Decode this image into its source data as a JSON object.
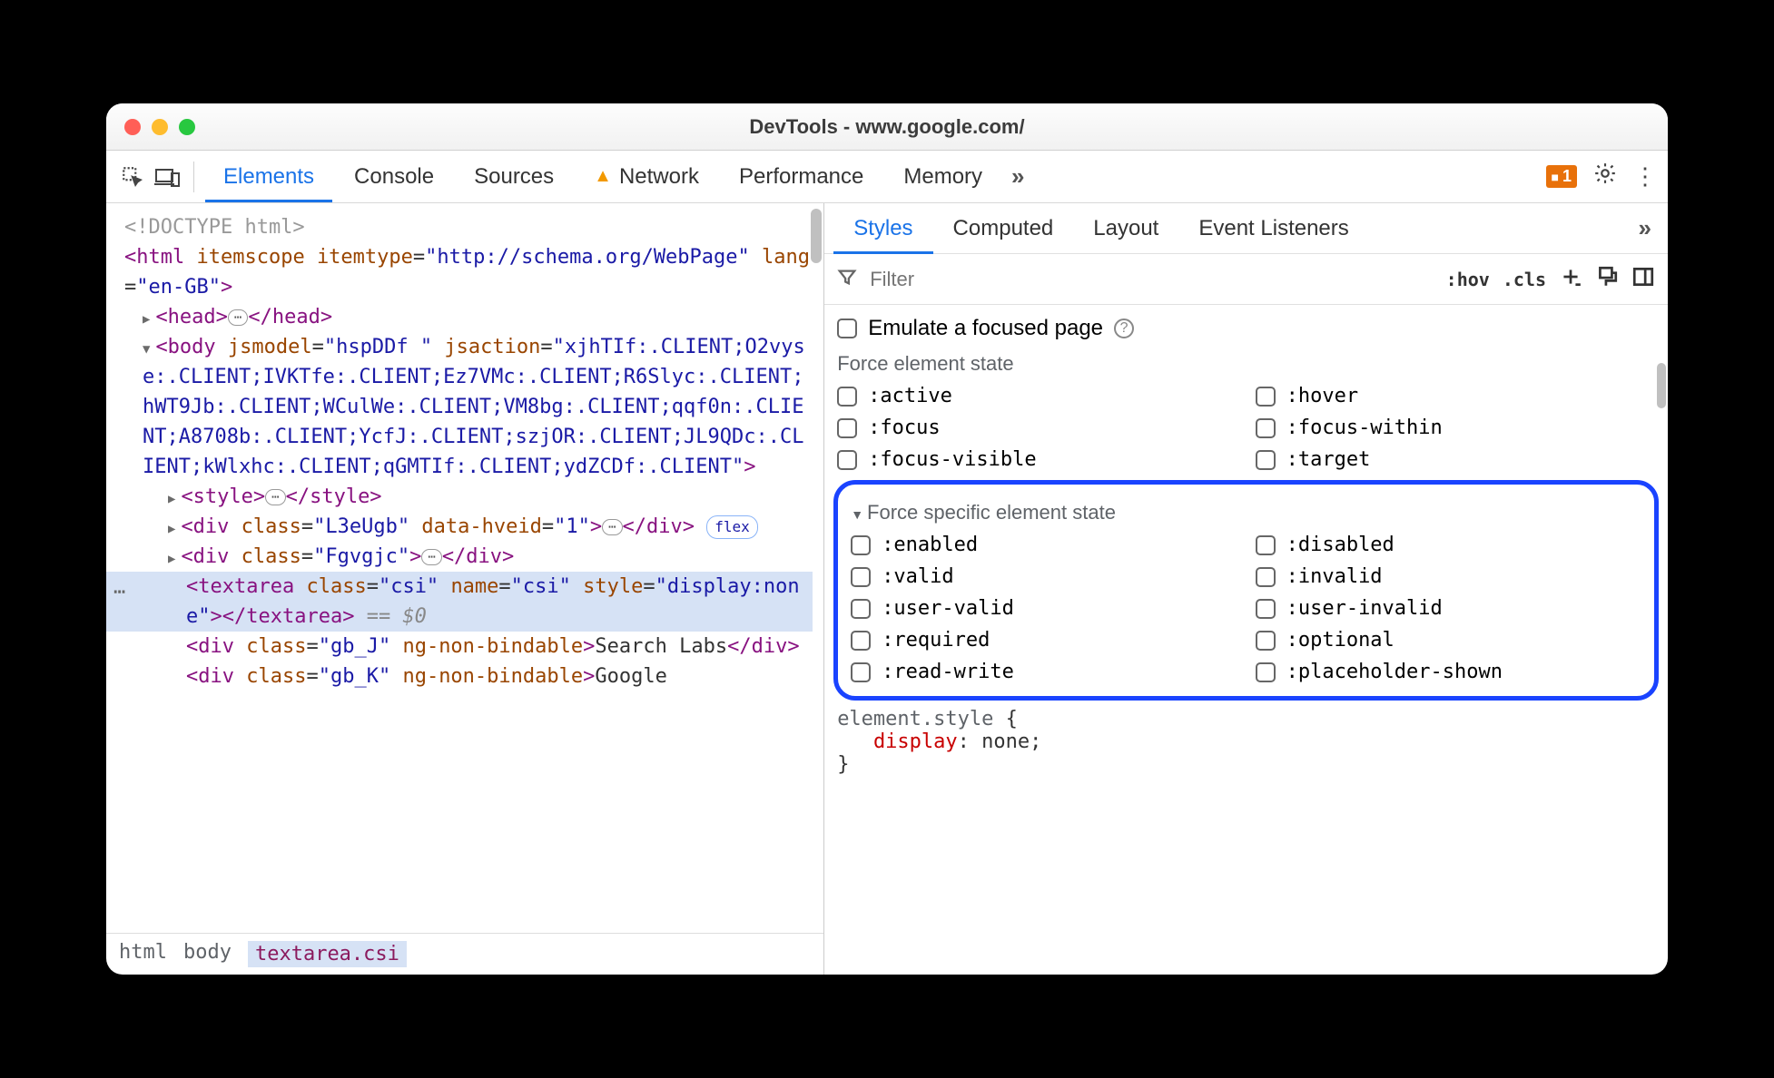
{
  "window": {
    "title": "DevTools - www.google.com/"
  },
  "tabs": {
    "elements": "Elements",
    "console": "Console",
    "sources": "Sources",
    "network": "Network",
    "performance": "Performance",
    "memory": "Memory"
  },
  "issues_count": "1",
  "dom": {
    "doctype": "<!DOCTYPE html>",
    "html_open_1": "<html",
    "html_itemscope": " itemscope ",
    "html_itemtype_attr": "itemtype",
    "html_itemtype_val": "\"http://schema.org/WebPage\"",
    "html_lang_attr": "lang",
    "html_lang_val": "\"en-GB\"",
    "html_close": ">",
    "head_open": "<head>",
    "head_close": "</head>",
    "body_open": "<body",
    "body_jsmodel_attr": "jsmodel",
    "body_jsmodel_val": "\"hspDDf \"",
    "body_jsaction_attr": "jsaction",
    "body_jsaction_val": "\"xjhTIf:.CLIENT;O2vyse:.CLIENT;IVKTfe:.CLIENT;Ez7VMc:.CLIENT;R6Slyc:.CLIENT;hWT9Jb:.CLIENT;WCulWe:.CLIENT;VM8bg:.CLIENT;qqf0n:.CLIENT;A8708b:.CLIENT;YcfJ:.CLIENT;szjOR:.CLIENT;JL9QDc:.CLIENT;kWlxhc:.CLIENT;qGMTIf:.CLIENT;ydZCDf:.CLIENT\"",
    "body_close": ">",
    "style_open": "<style>",
    "style_close": "</style>",
    "div1_open": "<div",
    "div1_class_attr": "class",
    "div1_class_val": "\"L3eUgb\"",
    "div1_hveid_attr": "data-hveid",
    "div1_hveid_val": "\"1\"",
    "div1_close": ">",
    "div1_end": "</div>",
    "flex_badge": "flex",
    "div2_open": "<div",
    "div2_class_attr": "class",
    "div2_class_val": "\"Fgvgjc\"",
    "div2_close": ">",
    "div2_end": "</div>",
    "ta_open": "<textarea",
    "ta_class_attr": "class",
    "ta_class_val": "\"csi\"",
    "ta_name_attr": "name",
    "ta_name_val": "\"csi\"",
    "ta_style_attr": "style",
    "ta_style_val": "\"display:none\"",
    "ta_close": ">",
    "ta_end": "</textarea>",
    "eqzero": " == $0",
    "div3_open": "<div",
    "div3_class_attr": "class",
    "div3_class_val": "\"gb_J\"",
    "div3_ng": "ng-non-bindable",
    "div3_close": ">",
    "div3_text": "Search Labs",
    "div3_end": "</div>",
    "div4_open": "<div",
    "div4_class_attr": "class",
    "div4_class_val": "\"gb_K\"",
    "div4_ng": "ng-non-bindable",
    "div4_close": ">",
    "div4_text": "Google"
  },
  "breadcrumbs": {
    "b1": "html",
    "b2": "body",
    "b3": "textarea.csi"
  },
  "right_tabs": {
    "styles": "Styles",
    "computed": "Computed",
    "layout": "Layout",
    "listeners": "Event Listeners"
  },
  "filter": {
    "placeholder": "Filter",
    "hov": ":hov",
    "cls": ".cls"
  },
  "emulate_label": "Emulate a focused page",
  "force_state_h": "Force element state",
  "states1": {
    "active": ":active",
    "hover": ":hover",
    "focus": ":focus",
    "focus_within": ":focus-within",
    "focus_visible": ":focus-visible",
    "target": ":target"
  },
  "force_specific_h": "Force specific element state",
  "states2": {
    "enabled": ":enabled",
    "disabled": ":disabled",
    "valid": ":valid",
    "invalid": ":invalid",
    "user_valid": ":user-valid",
    "user_invalid": ":user-invalid",
    "required": ":required",
    "optional": ":optional",
    "read_write": ":read-write",
    "placeholder_shown": ":placeholder-shown"
  },
  "style_block": {
    "sel": "element.style",
    "open": " {",
    "prop": "display",
    "val": ": none;",
    "close": "}"
  }
}
